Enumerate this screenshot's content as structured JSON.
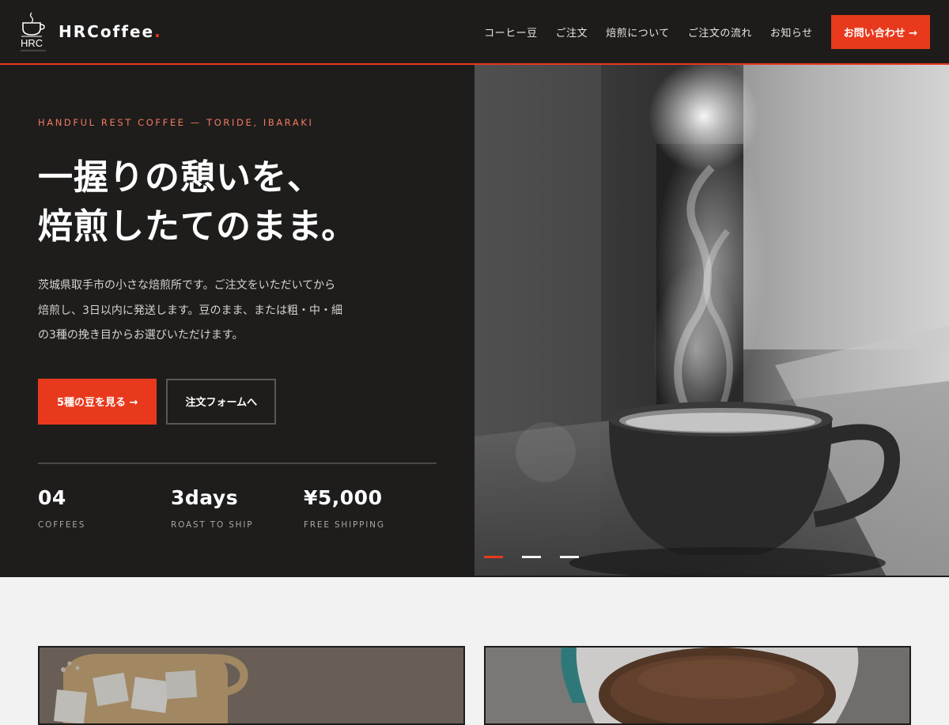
{
  "header": {
    "logo_text": "HRC",
    "brand_name": "HRCoffee",
    "brand_dot": ".",
    "nav": [
      {
        "label": "コーヒー豆"
      },
      {
        "label": "ご注文"
      },
      {
        "label": "焙煎について"
      },
      {
        "label": "ご注文の流れ"
      },
      {
        "label": "お知らせ"
      }
    ],
    "cta_label": "お問い合わせ →"
  },
  "hero": {
    "eyebrow": "HANDFUL REST COFFEE — TORIDE, IBARAKI",
    "headline_line1": "一握りの憩いを、",
    "headline_line2": "焙煎したてのまま。",
    "lead_line1": "茨城県取手市の小さな焙煎所です。ご注文をいただいてから",
    "lead_line2": "焙煎し、3日以内に発送します。豆のまま、または粗・中・細",
    "lead_line3": "の3種の挽き目からお選びいただけます。",
    "primary_button": "5種の豆を見る →",
    "secondary_button": "注文フォームへ",
    "stats": [
      {
        "value": "04",
        "label": "COFFEES"
      },
      {
        "value": "3days",
        "label": "ROAST TO SHIP"
      },
      {
        "value": "¥5,000",
        "label": "FREE SHIPPING"
      }
    ],
    "slider": {
      "count": 3,
      "active_index": 0
    }
  },
  "colors": {
    "accent": "#e8391c",
    "dark_bg": "#1f1d1c",
    "light_bg": "#f2f2f2"
  },
  "icons": {
    "logo": "coffee-cup-icon",
    "arrow": "arrow-right-icon"
  }
}
